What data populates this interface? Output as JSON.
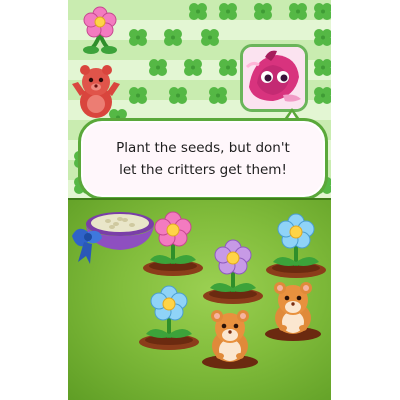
{
  "dialog": {
    "line1": "Plant the seeds, but don't",
    "line2": "let the critters get them!"
  },
  "hud": {
    "flower_color": "#f37bc0",
    "portrait_character": "pink pony"
  },
  "field": {
    "plants": [
      {
        "kind": "flower",
        "color": "pink"
      },
      {
        "kind": "flower",
        "color": "blue"
      },
      {
        "kind": "flower",
        "color": "purple"
      },
      {
        "kind": "flower",
        "color": "blue"
      }
    ],
    "critters": [
      {
        "kind": "hamster",
        "state": "peeking"
      },
      {
        "kind": "hamster",
        "state": "peeking"
      }
    ]
  },
  "colors": {
    "border_green": "#5aa83a",
    "stripe_light": "#e3f6d3",
    "stripe_dark": "#c9ecb0",
    "grass": "#82bd3c"
  }
}
